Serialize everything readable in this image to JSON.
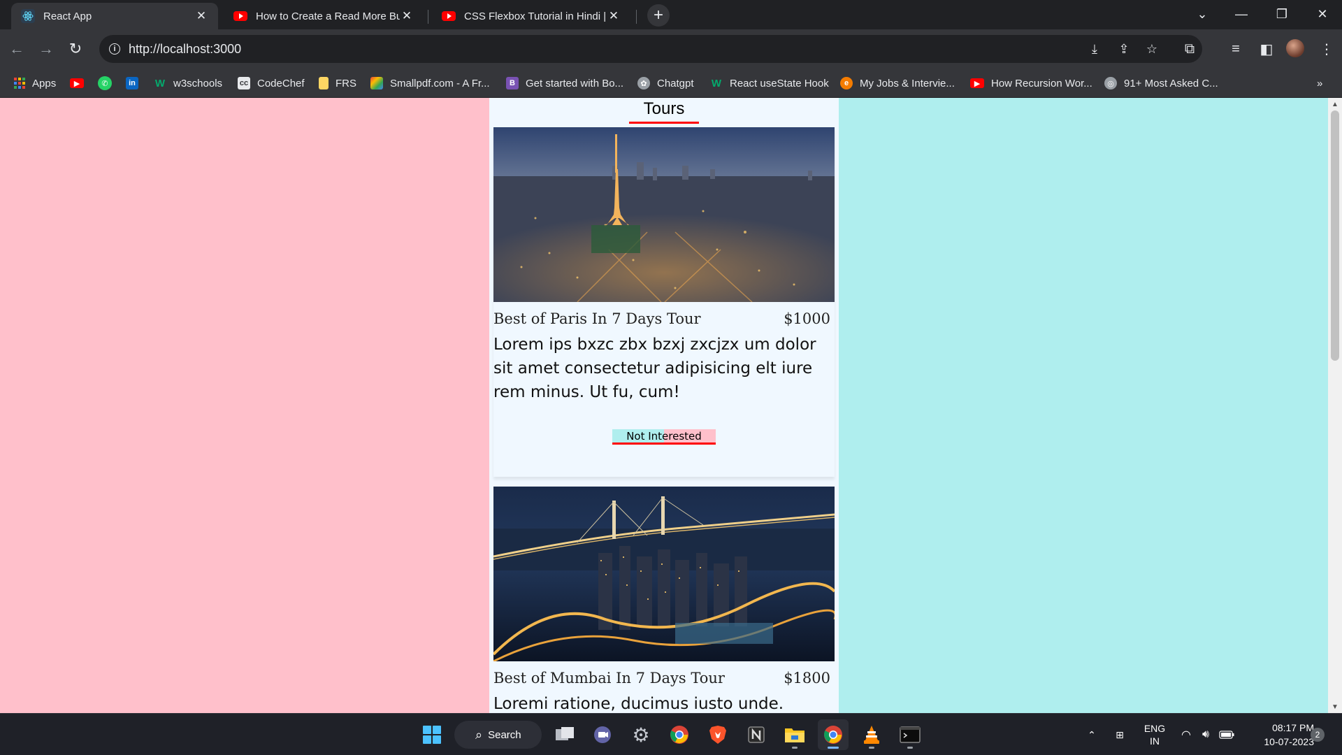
{
  "browser": {
    "tabs": [
      {
        "title": "React App",
        "active": true
      },
      {
        "title": "How to Create a Read More Butt",
        "active": false
      },
      {
        "title": "CSS Flexbox Tutorial in Hindi | W",
        "active": false
      }
    ],
    "url": "http://localhost:3000",
    "bookmarks": [
      {
        "label": "Apps"
      },
      {
        "label": ""
      },
      {
        "label": ""
      },
      {
        "label": ""
      },
      {
        "label": "w3schools"
      },
      {
        "label": "CodeChef"
      },
      {
        "label": "FRS"
      },
      {
        "label": "Smallpdf.com - A Fr..."
      },
      {
        "label": "Get started with Bo..."
      },
      {
        "label": "Chatgpt"
      },
      {
        "label": "React useState Hook"
      },
      {
        "label": "My Jobs & Intervie..."
      },
      {
        "label": "How Recursion Wor..."
      },
      {
        "label": "91+ Most Asked C..."
      }
    ],
    "overflow_label": "»"
  },
  "page": {
    "title": "Tours",
    "tours": [
      {
        "name": "Best of Paris In 7 Days Tour",
        "price": "$1000",
        "info": "Lorem ips bxzc zbx bzxj zxcjzx um dolor sit amet consectetur adipisicing elt iure rem minus. Ut fu, cum!",
        "button": "Not Interested"
      },
      {
        "name": "Best of Mumbai In 7 Days Tour",
        "price": "$1800",
        "info": "Loremi ratione, ducimus iusto unde. Dolor,"
      }
    ],
    "colors": {
      "left_panel": "#ffc0cb",
      "right_panel": "#afeeee",
      "center": "#f0f8ff",
      "underline": "#ff0000"
    }
  },
  "taskbar": {
    "search_label": "Search",
    "lang_top": "ENG",
    "lang_bottom": "IN",
    "time": "08:17 PM",
    "date": "10-07-2023",
    "notifications": "2"
  }
}
